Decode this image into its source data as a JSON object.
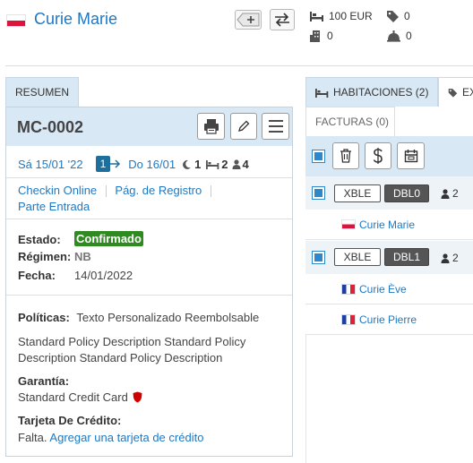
{
  "header": {
    "guest_name": "Curie Marie",
    "stats": {
      "amount": "100 EUR",
      "tags_count": "0",
      "rooms_count": "0",
      "notes_count": "0"
    }
  },
  "left_tab": "RESUMEN",
  "reservation": {
    "code": "MC-0002",
    "checkin_date": "Sá 15/01 '22",
    "nights": "1",
    "checkout_date": "Do 16/01",
    "moon_count": "1",
    "bed_count": "2",
    "person_count": "4"
  },
  "links": {
    "checkin_online": "Checkin Online",
    "pag_registro": "Pág. de Registro",
    "parte_entrada": "Parte Entrada"
  },
  "details": {
    "estado_label": "Estado:",
    "estado_value": "Confirmado",
    "regimen_label": "Régimen:",
    "regimen_value": "NB",
    "fecha_label": "Fecha:",
    "fecha_value": "14/01/2022"
  },
  "policies": {
    "politicas_label": "Políticas:",
    "politicas_value": "Texto Personalizado Reembolsable",
    "description": "Standard Policy Description Standard Policy Description Standard Policy Description",
    "garantia_label": "Garantía:",
    "garantia_value": "Standard Credit Card",
    "tarjeta_label": "Tarjeta De Crédito:",
    "tarjeta_missing": "Falta.",
    "tarjeta_link": "Agregar una tarjeta de crédito"
  },
  "right_tabs": {
    "habitaciones": "HABITACIONES (2)",
    "extras": "EX",
    "facturas": "FACTURAS (0)"
  },
  "rooms": [
    {
      "type": "XBLE",
      "code": "DBL0",
      "guests": "2",
      "occupants": [
        "Curie Marie"
      ]
    },
    {
      "type": "XBLE",
      "code": "DBL1",
      "guests": "2",
      "occupants": [
        "Curie Ève",
        "Curie Pierre"
      ]
    }
  ],
  "colors": {
    "accent": "#1f78c1",
    "panel_header": "#d9e8f5",
    "confirmed_badge": "#2e8b1f",
    "guarantee_shield": "#cc0000"
  }
}
